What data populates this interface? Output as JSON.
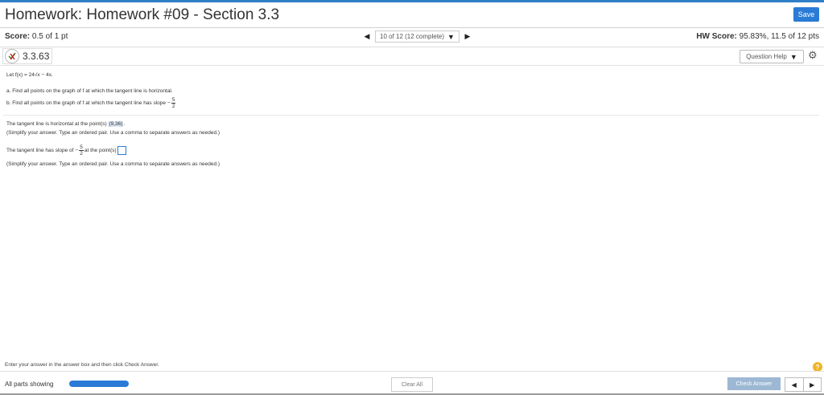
{
  "header": {
    "title": "Homework: Homework #09 - Section 3.3",
    "save_label": "Save"
  },
  "score_bar": {
    "score_label": "Score:",
    "score_value": "0.5 of 1 pt",
    "nav_prev_icon": "triangle-left-icon",
    "nav_selected": "10 of 12 (12 complete)",
    "nav_next_icon": "triangle-right-icon",
    "hw_score_label": "HW Score:",
    "hw_score_value": "95.83%, 11.5 of 12 pts"
  },
  "question_bar": {
    "question_id": "3.3.63",
    "help_label": "Question Help",
    "status_icon": "partially-correct-icon",
    "settings_icon": "gear-icon"
  },
  "problem": {
    "function_def": "Let f(x) = 24√x − 4x.",
    "part_a": "a. Find all points on the graph of f at which the tangent line is horizontal.",
    "part_b_prefix": "b. Find all points on the graph of f at which the tangent line has slope",
    "part_b_frac_sign": "−",
    "part_b_frac_num": "5",
    "part_b_frac_den": "2"
  },
  "answers": {
    "a_prefix": "The tangent line is horizontal at the point(s)",
    "a_value": "(9,36)",
    "a_hint": "(Simplify your answer. Type an ordered pair. Use a comma to separate answers as needed.)",
    "b_prefix": "The tangent line has slope of",
    "b_frac_sign": "−",
    "b_frac_num": "5",
    "b_frac_den": "2",
    "b_suffix": "at the point(s)",
    "b_hint": "(Simplify your answer. Type an ordered pair. Use a comma to separate answers as needed.)"
  },
  "footer": {
    "instruction": "Enter your answer in the answer box and then click Check Answer.",
    "help_icon": "question-circle-icon",
    "all_parts_label": "All parts showing",
    "progress_fraction": 1.0,
    "clear_all_label": "Clear All",
    "check_answer_label": "Check Answer"
  },
  "colors": {
    "accent": "#2a7bd6",
    "check_answer_bg": "#9db8d4",
    "help_icon": "#f0b429",
    "answer_highlight": "#dde6f2"
  }
}
